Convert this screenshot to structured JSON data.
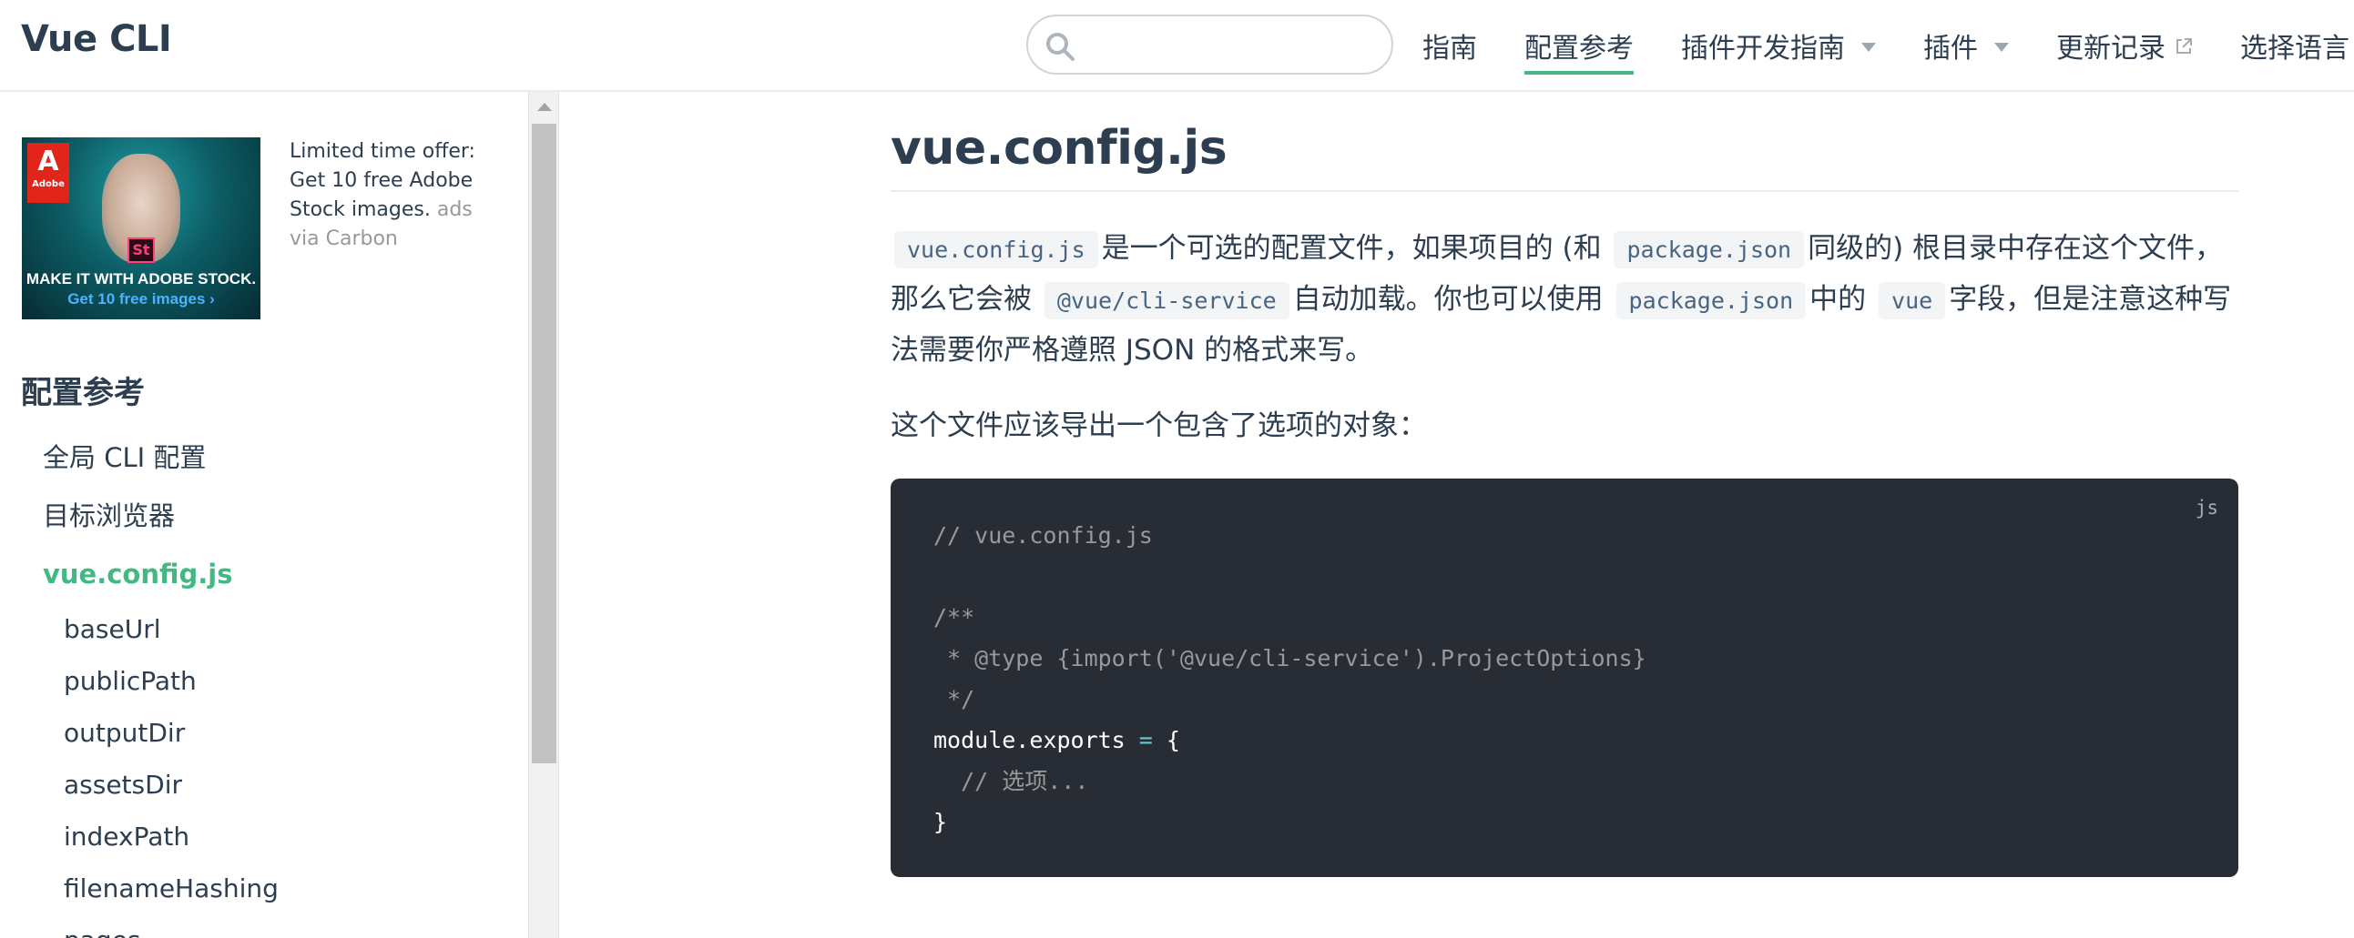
{
  "navbar": {
    "site_name": "Vue CLI",
    "search": {
      "value": "",
      "placeholder": ""
    },
    "links": [
      {
        "label": "指南"
      },
      {
        "label": "配置参考"
      },
      {
        "label": "插件开发指南"
      },
      {
        "label": "插件"
      },
      {
        "label": "更新记录"
      },
      {
        "label": "选择语言"
      }
    ]
  },
  "sidebar": {
    "ad": {
      "brand": "Adobe",
      "badge": "St",
      "tagline": "MAKE IT WITH ADOBE STOCK.",
      "cta": "Get 10 free images ›",
      "text": "Limited time offer: Get 10 free Adobe Stock images.",
      "via": "ads via Carbon"
    },
    "heading": "配置参考",
    "items": [
      {
        "label": "全局 CLI 配置"
      },
      {
        "label": "目标浏览器"
      },
      {
        "label": "vue.config.js"
      }
    ],
    "subitems": [
      {
        "label": "baseUrl"
      },
      {
        "label": "publicPath"
      },
      {
        "label": "outputDir"
      },
      {
        "label": "assetsDir"
      },
      {
        "label": "indexPath"
      },
      {
        "label": "filenameHashing"
      },
      {
        "label": "pages"
      }
    ]
  },
  "content": {
    "title": "vue.config.js",
    "para1": {
      "code1": "vue.config.js",
      "t1": "是一个可选的配置文件，如果项目的 (和",
      "code2": "package.json",
      "t2": "同级的) 根目录中存在这个文件，那么它会被",
      "code3": "@vue/cli-service",
      "t3": "自动加载。你也可以使用",
      "code4": "package.json",
      "t4": "中的",
      "code5": "vue",
      "t5": "字段，但是注意这种写法需要你严格遵照 JSON 的格式来写。"
    },
    "para2": "这个文件应该导出一个包含了选项的对象：",
    "code": {
      "lang": "js",
      "line1": "// vue.config.js",
      "line3": "/**",
      "line4": " * @type {import('@vue/cli-service').ProjectOptions}",
      "line5": " */",
      "line6a": "module.exports",
      "line6b": "=",
      "line6c": "{",
      "line7": "  // 选项...",
      "line8": "}"
    }
  },
  "colors": {
    "accent": "#42b983",
    "text": "#2c3e50",
    "code_bg": "#282c34"
  }
}
